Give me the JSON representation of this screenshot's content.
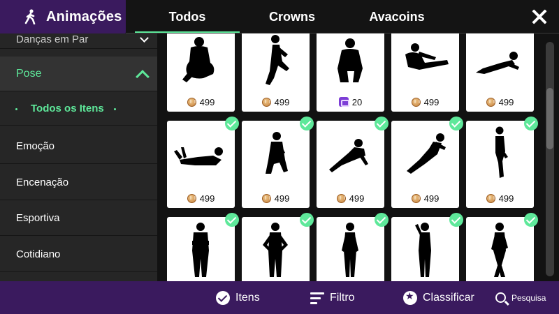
{
  "header": {
    "title": "Animações",
    "tabs": [
      {
        "label": "Todos",
        "active": true
      },
      {
        "label": "Crowns",
        "active": false
      },
      {
        "label": "Avacoins",
        "active": false
      }
    ],
    "accent_color": "#5ee89a",
    "brand_color": "#3a1a5e"
  },
  "sidebar": {
    "cut_item": "Danças em Par",
    "expanded": "Pose",
    "sub_item": "Todos os Itens",
    "items": [
      "Emoção",
      "Encenação",
      "Esportiva",
      "Cotidiano"
    ]
  },
  "grid": {
    "rows": [
      [
        {
          "price": "499",
          "currency": "avacoin",
          "owned": false,
          "pose": "sitting-knees"
        },
        {
          "price": "499",
          "currency": "avacoin",
          "owned": false,
          "pose": "kneeling-side"
        },
        {
          "price": "20",
          "currency": "crown",
          "owned": false,
          "pose": "squat"
        },
        {
          "price": "499",
          "currency": "avacoin",
          "owned": false,
          "pose": "stretch-floor"
        },
        {
          "price": "499",
          "currency": "avacoin",
          "owned": false,
          "pose": "lying-prone"
        }
      ],
      [
        {
          "price": "499",
          "currency": "avacoin",
          "owned": true,
          "pose": "lying-chin"
        },
        {
          "price": "499",
          "currency": "avacoin",
          "owned": true,
          "pose": "sitting-knee-up"
        },
        {
          "price": "499",
          "currency": "avacoin",
          "owned": true,
          "pose": "lying-side"
        },
        {
          "price": "499",
          "currency": "avacoin",
          "owned": true,
          "pose": "reclined"
        },
        {
          "price": "499",
          "currency": "avacoin",
          "owned": true,
          "pose": "standing-side"
        }
      ],
      [
        {
          "price": "",
          "currency": "",
          "owned": true,
          "pose": "standing-arms-crossed"
        },
        {
          "price": "",
          "currency": "",
          "owned": true,
          "pose": "standing-hands-hips"
        },
        {
          "price": "",
          "currency": "",
          "owned": true,
          "pose": "standing-casual"
        },
        {
          "price": "",
          "currency": "",
          "owned": true,
          "pose": "standing-hand-head"
        },
        {
          "price": "",
          "currency": "",
          "owned": true,
          "pose": "standing-crossed-legs"
        }
      ]
    ]
  },
  "bottombar": {
    "items_label": "Itens",
    "filter_label": "Filtro",
    "sort_label": "Classificar",
    "search_label": "Pesquisa"
  }
}
